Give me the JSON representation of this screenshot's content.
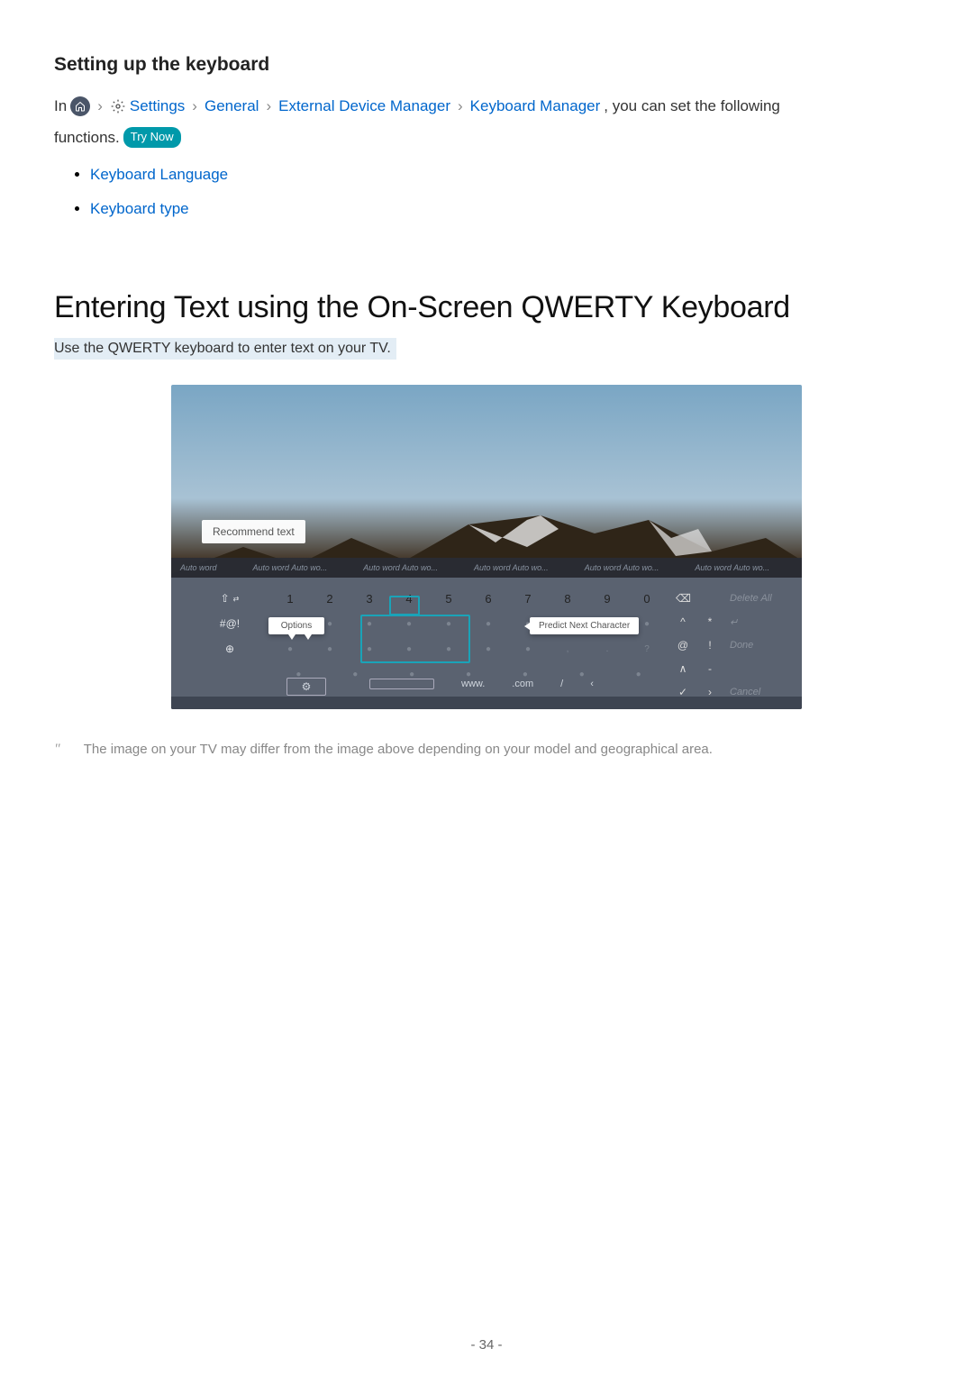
{
  "section_title": "Setting up the keyboard",
  "para": {
    "in": "In",
    "settings": "Settings",
    "general": "General",
    "edm": "External Device Manager",
    "km": "Keyboard Manager",
    "tail": ", you can set the following",
    "line2": "functions.",
    "trynow": "Try Now"
  },
  "options": {
    "lang": "Keyboard Language",
    "type": "Keyboard type"
  },
  "heading": "Entering Text using the On-Screen QWERTY Keyboard",
  "lead": "Use the QWERTY keyboard to enter text on your TV.",
  "kb": {
    "recommend": "Recommend text",
    "options": "Options",
    "predict": "Predict Next Character",
    "shift": "⇧",
    "sym": "#@!",
    "globe": "⊕",
    "nums": [
      "1",
      "2",
      "3",
      "4",
      "5",
      "6",
      "7",
      "8",
      "9",
      "0"
    ],
    "backspace": "⌫",
    "enter": "↵",
    "at": "@",
    "excl": "!",
    "caret": "^",
    "star": "*",
    "dash": "-",
    "chk": "✓",
    "lt": "‹",
    "gt": "›",
    "www": "www.",
    "com": ".com",
    "slash": "/",
    "delall": "Delete All",
    "done": "Done",
    "cancel": "Cancel",
    "gear": "⚙"
  },
  "note": {
    "mark": "\"",
    "text": "The image on your TV may differ from the image above depending on your model and geographical area."
  },
  "page": "- 34 -"
}
